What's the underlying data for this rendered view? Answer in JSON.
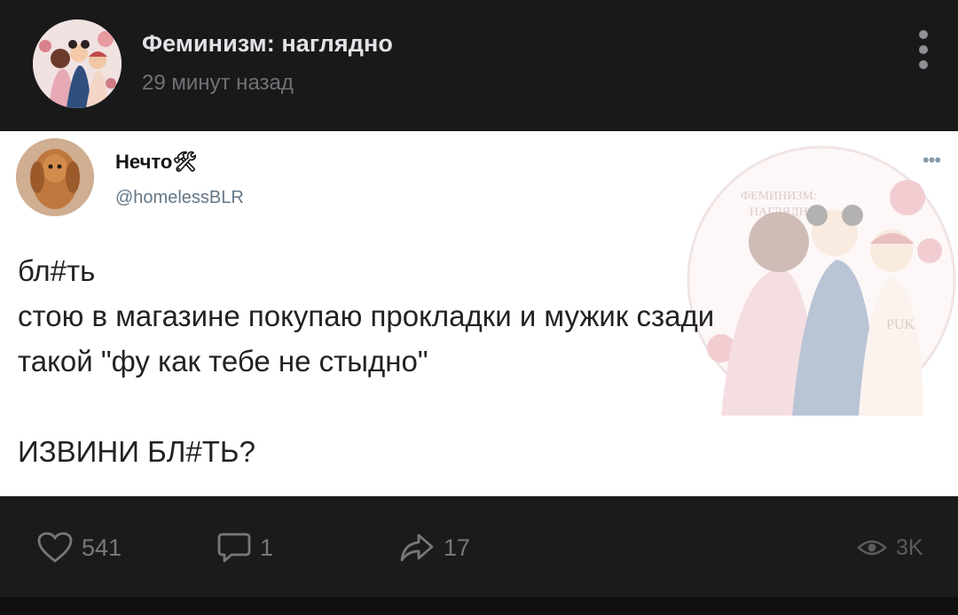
{
  "header": {
    "group_name": "Феминизм: наглядно",
    "time_ago": "29 минут назад",
    "avatar_icon": "group-avatar-illustration",
    "menu_icon": "vertical-dots-icon"
  },
  "tweet": {
    "author_name": "Нечто",
    "author_emoji": "🛠",
    "handle": "@homelessBLR",
    "more_icon": "more-dots-icon",
    "body": "бл#ть\nстою в магазине покупаю прокладки и мужик сзади\nтакой \"фу как тебе не стыдно\"\n\nИЗВИНИ БЛ#ТЬ?",
    "watermark": {
      "line1": "ФЕМИНИЗМ:",
      "line2": "НАГЛЯДНО",
      "badge": "PUK"
    }
  },
  "actions": {
    "likes": "541",
    "comments": "1",
    "shares": "17",
    "views": "3K"
  },
  "colors": {
    "background": "#19191a",
    "card": "#ffffff",
    "muted": "#76787a"
  }
}
